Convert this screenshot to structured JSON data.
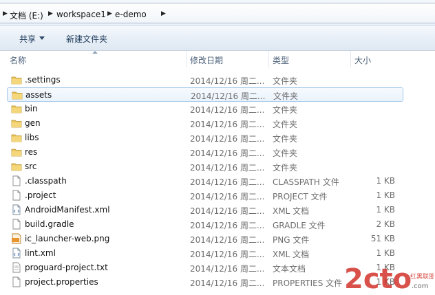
{
  "address": {
    "crumbs": [
      "文档 (E:)",
      "workspace1",
      "e-demo"
    ]
  },
  "toolbar": {
    "share_label": "共享",
    "new_folder_label": "新建文件夹"
  },
  "columns": {
    "name": "名称",
    "date": "修改日期",
    "type": "类型",
    "size": "大小"
  },
  "files": [
    {
      "name": ".settings",
      "date": "2014/12/16 周二...",
      "type": "文件夹",
      "size": "",
      "icon": "folder-icon"
    },
    {
      "name": "assets",
      "date": "2014/12/16 周二...",
      "type": "文件夹",
      "size": "",
      "icon": "folder-icon",
      "selected": true
    },
    {
      "name": "bin",
      "date": "2014/12/16 周二...",
      "type": "文件夹",
      "size": "",
      "icon": "folder-icon"
    },
    {
      "name": "gen",
      "date": "2014/12/16 周二...",
      "type": "文件夹",
      "size": "",
      "icon": "folder-icon"
    },
    {
      "name": "libs",
      "date": "2014/12/16 周二...",
      "type": "文件夹",
      "size": "",
      "icon": "folder-icon"
    },
    {
      "name": "res",
      "date": "2014/12/16 周二...",
      "type": "文件夹",
      "size": "",
      "icon": "folder-icon"
    },
    {
      "name": "src",
      "date": "2014/12/16 周二...",
      "type": "文件夹",
      "size": "",
      "icon": "folder-icon"
    },
    {
      "name": ".classpath",
      "date": "2014/12/16 周二...",
      "type": "CLASSPATH 文件",
      "size": "1 KB",
      "icon": "file-icon"
    },
    {
      "name": ".project",
      "date": "2014/12/16 周二...",
      "type": "PROJECT 文件",
      "size": "1 KB",
      "icon": "file-icon"
    },
    {
      "name": "AndroidManifest.xml",
      "date": "2014/12/16 周二...",
      "type": "XML 文档",
      "size": "1 KB",
      "icon": "xml-file-icon"
    },
    {
      "name": "build.gradle",
      "date": "2014/12/16 周二...",
      "type": "GRADLE 文件",
      "size": "2 KB",
      "icon": "file-icon"
    },
    {
      "name": "ic_launcher-web.png",
      "date": "2014/12/16 周二...",
      "type": "PNG 文件",
      "size": "51 KB",
      "icon": "png-file-icon"
    },
    {
      "name": "lint.xml",
      "date": "2014/12/16 周二...",
      "type": "XML 文档",
      "size": "1 KB",
      "icon": "xml-file-icon"
    },
    {
      "name": "proguard-project.txt",
      "date": "2014/12/16 周二...",
      "type": "文本文档",
      "size": "1 KB",
      "icon": "text-file-icon"
    },
    {
      "name": "project.properties",
      "date": "2014/12/16 周二...",
      "type": "PROPERTIES 文件",
      "size": "1 KB",
      "icon": "file-icon"
    }
  ],
  "watermark": {
    "logo": "2cto",
    "subtitle": "红黑联盟",
    "url": ".com"
  },
  "colors": {
    "folder": "#e8c35a",
    "selection_border": "#a7c9ec",
    "watermark": "#d2332b"
  }
}
